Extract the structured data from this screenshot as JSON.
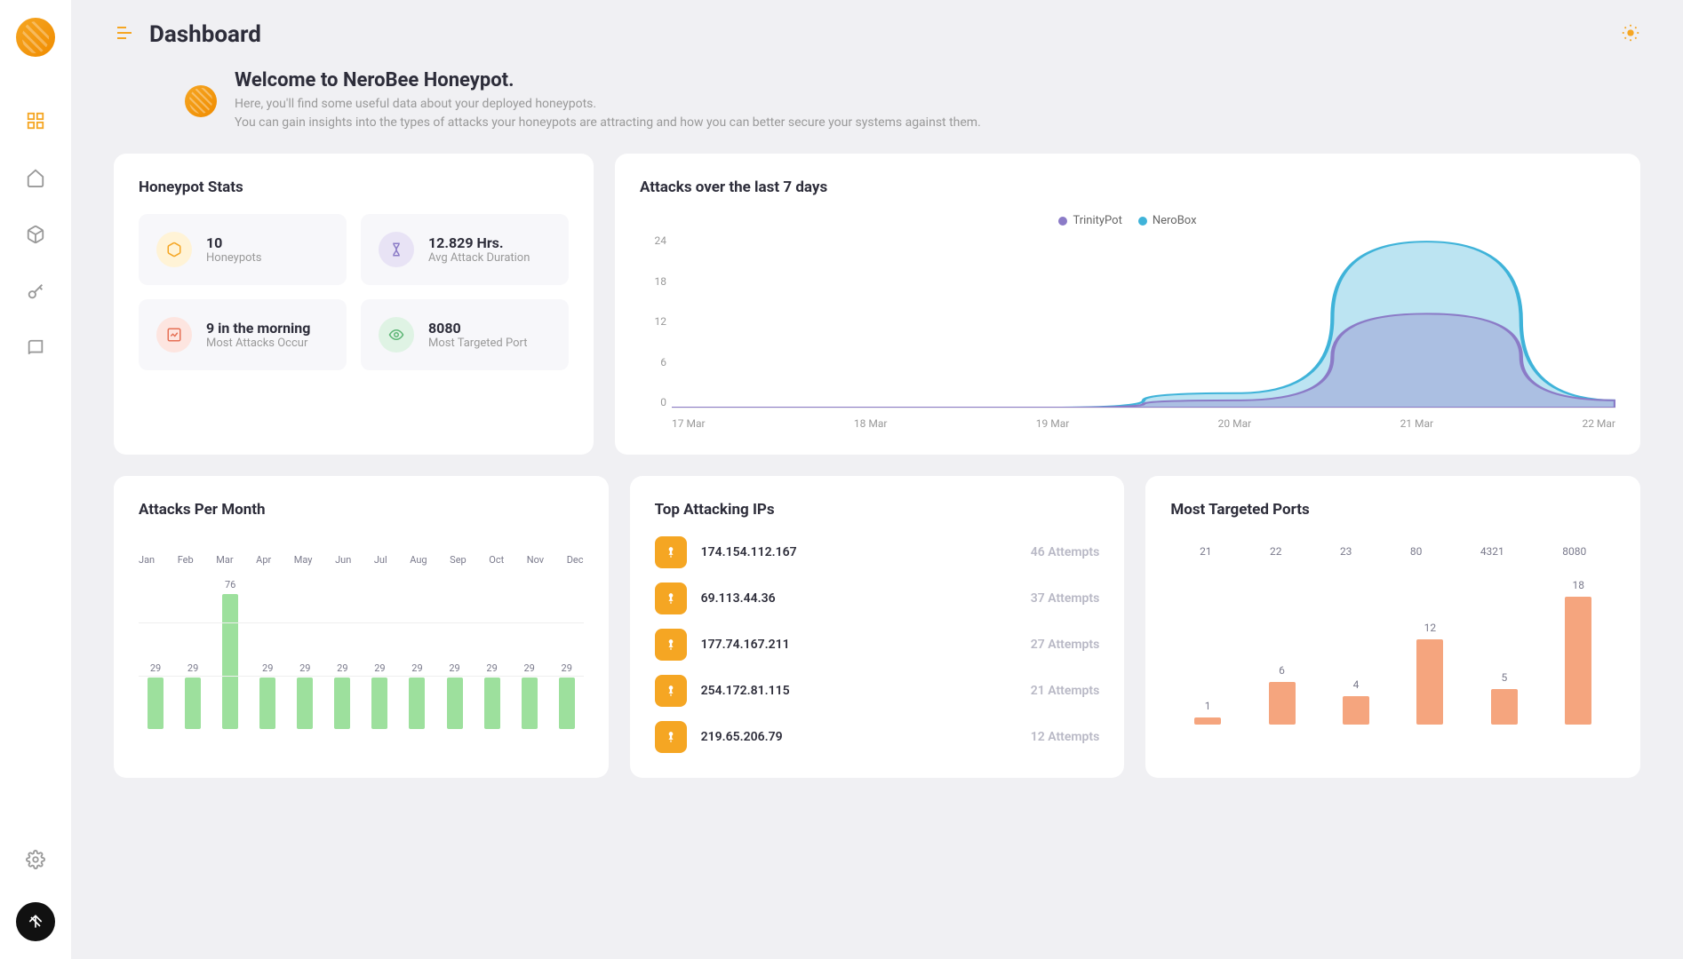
{
  "page_title": "Dashboard",
  "welcome": {
    "heading": "Welcome to NeroBee Honeypot.",
    "line1": "Here, you'll find some useful data about your deployed honeypots.",
    "line2": "You can gain insights into the types of attacks your honeypots are attracting and how you can better secure your systems against them."
  },
  "stats": {
    "title": "Honeypot Stats",
    "items": [
      {
        "value": "10",
        "label": "Honeypots",
        "icon": "cube",
        "color": "yellow"
      },
      {
        "value": "12.829 Hrs.",
        "label": "Avg Attack Duration",
        "icon": "hourglass",
        "color": "purple"
      },
      {
        "value": "9 in the morning",
        "label": "Most Attacks Occur",
        "icon": "trend",
        "color": "red"
      },
      {
        "value": "8080",
        "label": "Most Targeted Port",
        "icon": "eye",
        "color": "green"
      }
    ]
  },
  "attacks_7d": {
    "title": "Attacks over the last 7 days",
    "legend": [
      {
        "name": "TrinityPot",
        "color": "#8b7bc7"
      },
      {
        "name": "NeroBox",
        "color": "#3fb3d9"
      }
    ]
  },
  "chart_data": {
    "attacks_7d": {
      "type": "area",
      "x": [
        "17 Mar",
        "18 Mar",
        "19 Mar",
        "20 Mar",
        "21 Mar",
        "22 Mar"
      ],
      "ylim": [
        0,
        24
      ],
      "yticks": [
        0,
        6,
        12,
        18,
        24
      ],
      "series": [
        {
          "name": "TrinityPot",
          "color": "#8b7bc7",
          "values": [
            0,
            0,
            0,
            1,
            13,
            1
          ]
        },
        {
          "name": "NeroBox",
          "color": "#3fb3d9",
          "values": [
            0,
            0,
            0,
            2,
            23,
            1
          ]
        }
      ]
    },
    "attacks_per_month": {
      "type": "bar",
      "categories": [
        "Jan",
        "Feb",
        "Mar",
        "Apr",
        "May",
        "Jun",
        "Jul",
        "Aug",
        "Sep",
        "Oct",
        "Nov",
        "Dec"
      ],
      "values": [
        29,
        29,
        76,
        29,
        29,
        29,
        29,
        29,
        29,
        29,
        29,
        29
      ],
      "ylim": [
        0,
        80
      ]
    },
    "most_targeted_ports": {
      "type": "bar",
      "categories": [
        "21",
        "22",
        "23",
        "80",
        "4321",
        "8080"
      ],
      "values": [
        1,
        6,
        4,
        12,
        5,
        18
      ],
      "ylim": [
        0,
        20
      ]
    }
  },
  "attacks_month": {
    "title": "Attacks Per Month"
  },
  "top_ips": {
    "title": "Top Attacking IPs",
    "rows": [
      {
        "ip": "174.154.112.167",
        "attempts": "46 Attempts"
      },
      {
        "ip": "69.113.44.36",
        "attempts": "37 Attempts"
      },
      {
        "ip": "177.74.167.211",
        "attempts": "27 Attempts"
      },
      {
        "ip": "254.172.81.115",
        "attempts": "21 Attempts"
      },
      {
        "ip": "219.65.206.79",
        "attempts": "12 Attempts"
      }
    ]
  },
  "ports": {
    "title": "Most Targeted Ports"
  }
}
